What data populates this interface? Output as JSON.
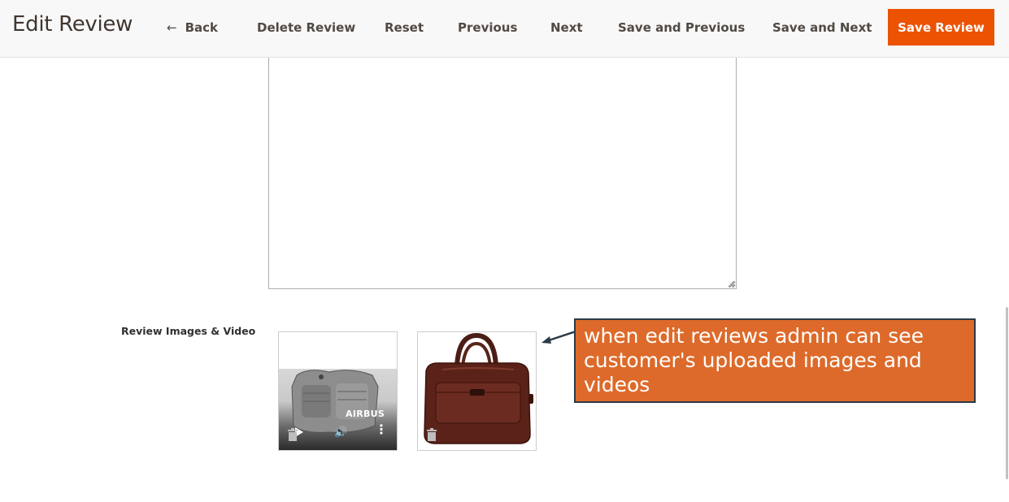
{
  "header": {
    "title": "Edit Review",
    "back_icon": "←",
    "back_label": "Back",
    "delete_label": "Delete Review",
    "reset_label": "Reset",
    "previous_label": "Previous",
    "next_label": "Next",
    "save_previous_label": "Save and Previous",
    "save_next_label": "Save and Next",
    "save_label": "Save Review",
    "accent_color": "#eb5202"
  },
  "form": {
    "review_text_value": ""
  },
  "media": {
    "label": "Review Images & Video",
    "items": [
      {
        "type": "video",
        "brand_text": "AIRBUS",
        "icons": [
          "play-icon",
          "volume-icon",
          "more-icon",
          "trash-icon"
        ]
      },
      {
        "type": "image",
        "subject": "brown leather laptop bag",
        "icons": [
          "trash-icon"
        ]
      }
    ]
  },
  "annotation": {
    "text": "when edit reviews admin can see customer's uploaded images and videos",
    "background_color": "#dd6a2a",
    "border_color": "#2b3a47"
  }
}
